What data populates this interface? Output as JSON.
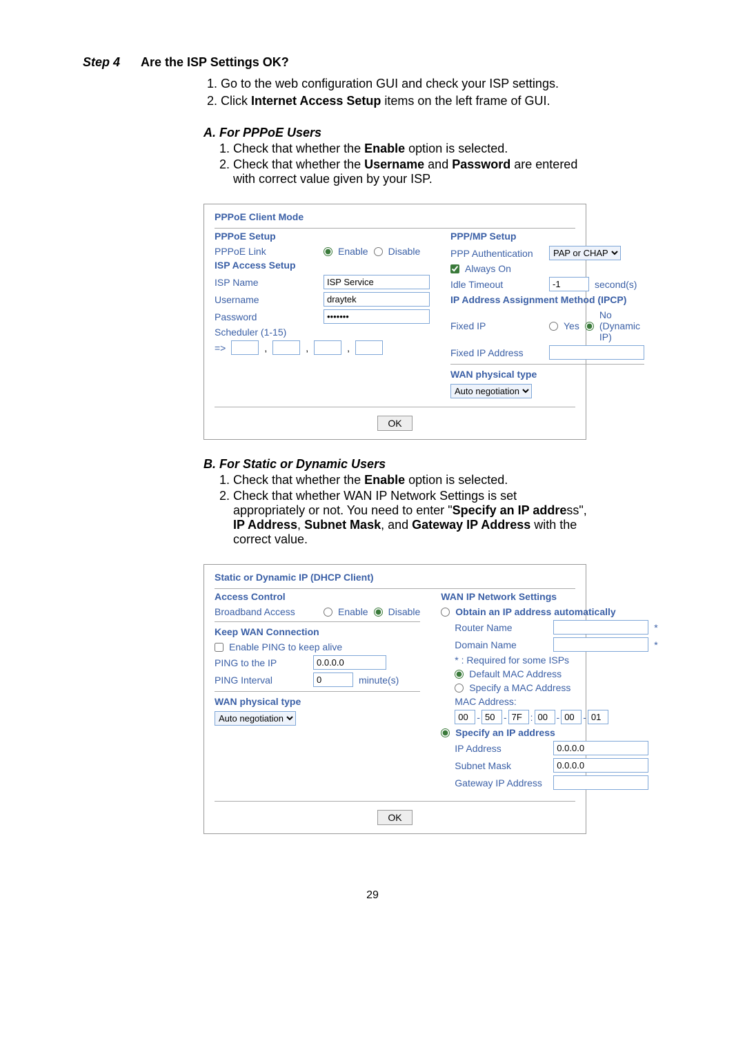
{
  "step_label": "Step 4",
  "step_title": "Are the ISP Settings OK?",
  "instr1": "1. Go to the web configuration GUI and check your ISP settings.",
  "instr2a": "2. Click ",
  "instr2b": "Internet Access Setup",
  "instr2c": " items on the left frame of GUI.",
  "secA_title": "A. For PPPoE Users",
  "secA_1a": "1. Check that whether the ",
  "secA_1b": "Enable",
  "secA_1c": " option is selected.",
  "secA_2a": "2. Check that whether the ",
  "secA_2b": "Username",
  "secA_2c": " and ",
  "secA_2d": "Password",
  "secA_2e": " are entered",
  "secA_2f": "with correct value given by your ISP.",
  "panel1": {
    "header": "PPPoE Client Mode",
    "pppoe_setup": "PPPoE Setup",
    "pppoe_link": "PPPoE Link",
    "enable": "Enable",
    "disable": "Disable",
    "isp_access": "ISP Access Setup",
    "isp_name": "ISP Name",
    "isp_name_val": "ISP Service",
    "username": "Username",
    "username_val": "draytek",
    "password": "Password",
    "password_val": "•••••••",
    "scheduler": "Scheduler (1-15)",
    "arrow": "=>",
    "ppp_mp": "PPP/MP Setup",
    "ppp_auth": "PPP Authentication",
    "ppp_auth_val": "PAP or CHAP",
    "always_on": "Always On",
    "idle_timeout": "Idle Timeout",
    "idle_val": "-1",
    "seconds": "second(s)",
    "ip_assign": "IP Address Assignment Method (IPCP)",
    "fixed_ip": "Fixed IP",
    "yes": "Yes",
    "no_dyn": "No (Dynamic IP)",
    "fixed_ip_addr": "Fixed IP Address",
    "wan_phys": "WAN physical type",
    "auto_neg": "Auto negotiation",
    "ok": "OK"
  },
  "secB_title": "B. For Static or Dynamic Users",
  "secB_1a": "1. Check that whether the ",
  "secB_1b": "Enable",
  "secB_1c": " option is selected.",
  "secB_2a": "2. Check that whether WAN IP Network Settings is set",
  "secB_2b": "appropriately or not. You need to enter \"",
  "secB_2c": "Specify an IP addre",
  "secB_2d": "ss\",",
  "secB_2e": "IP Address",
  "secB_2f": ", ",
  "secB_2g": "Subnet Mask",
  "secB_2h": ", and ",
  "secB_2i": "Gateway IP Address",
  "secB_2j": " with the",
  "secB_2k": "correct value.",
  "panel2": {
    "header": "Static or Dynamic IP (DHCP Client)",
    "access_control": "Access Control",
    "broadband": "Broadband Access",
    "enable": "Enable",
    "disable": "Disable",
    "keep_wan": "Keep WAN Connection",
    "enable_ping": "Enable PING to keep alive",
    "ping_ip": "PING to the IP",
    "ping_ip_val": "0.0.0.0",
    "ping_interval": "PING Interval",
    "ping_int_val": "0",
    "minutes": "minute(s)",
    "wan_phys": "WAN physical type",
    "auto_neg": "Auto negotiation",
    "wan_ip_settings": "WAN IP Network Settings",
    "obtain_auto": "Obtain an IP address automatically",
    "router_name": "Router Name",
    "domain_name": "Domain Name",
    "required": "* : Required for some ISPs",
    "default_mac": "Default MAC Address",
    "specify_mac": "Specify a MAC Address",
    "mac_address": "MAC Address:",
    "mac": [
      "00",
      "50",
      "7F",
      "00",
      "00",
      "01"
    ],
    "dash": "-",
    "colon": ":",
    "specify_ip": "Specify an IP address",
    "ip_addr": "IP Address",
    "ip_addr_val": "0.0.0.0",
    "subnet": "Subnet Mask",
    "subnet_val": "0.0.0.0",
    "gateway": "Gateway IP Address",
    "star": "*",
    "ok": "OK"
  },
  "page_num": "29"
}
